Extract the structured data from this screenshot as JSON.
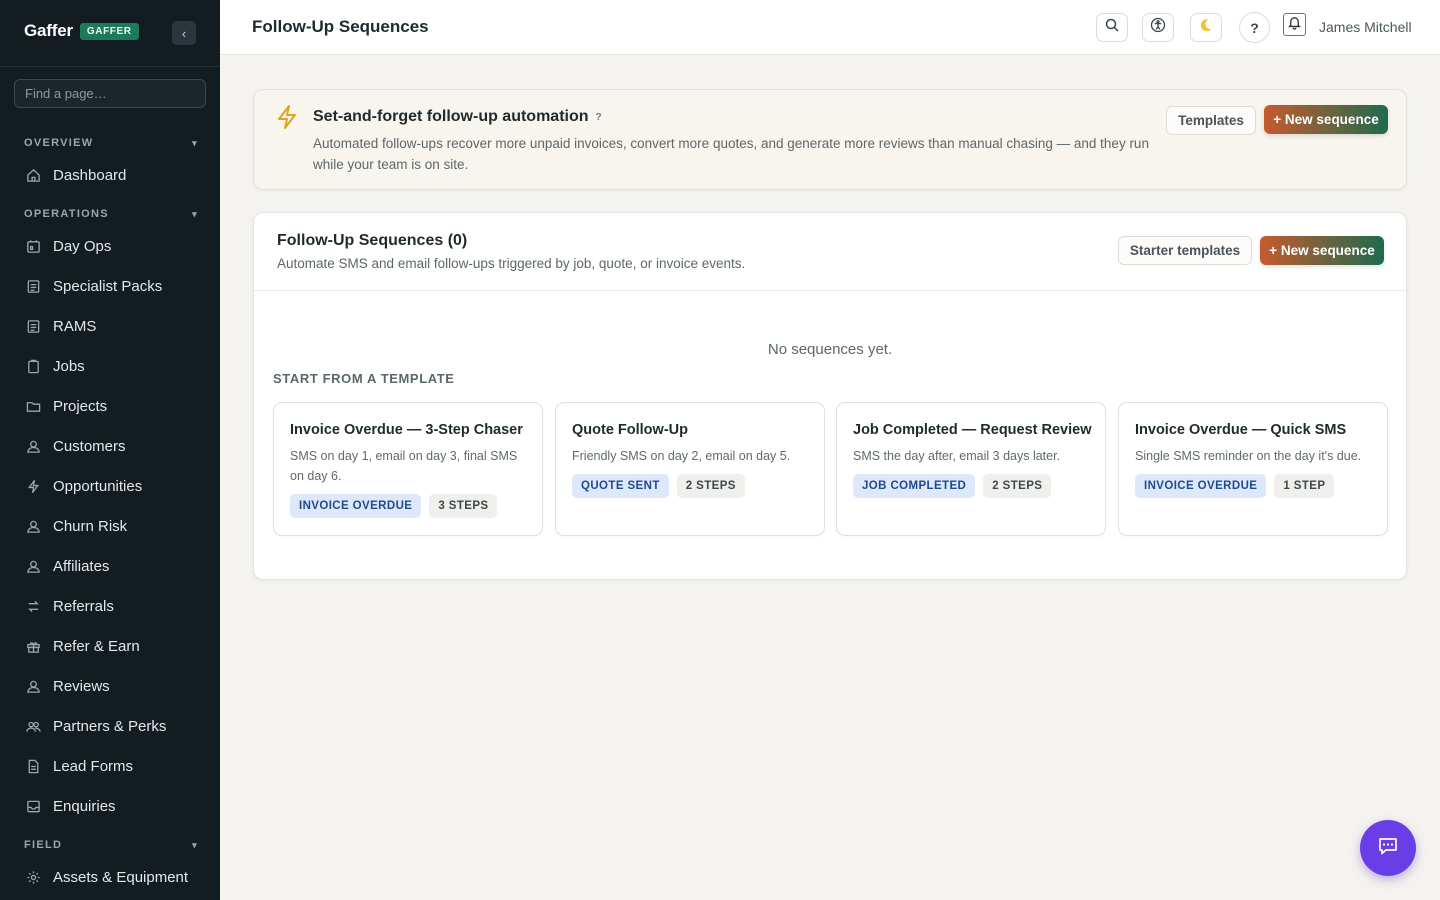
{
  "app": {
    "name": "Gaffer",
    "badge": "GAFFER"
  },
  "sidebar": {
    "search_placeholder": "Find a page…",
    "sections": {
      "overview": "OVERVIEW",
      "operations": "OPERATIONS",
      "field": "FIELD"
    },
    "items": {
      "dashboard": "Dashboard",
      "day_ops": "Day Ops",
      "specialist_packs": "Specialist Packs",
      "rams": "RAMS",
      "jobs": "Jobs",
      "projects": "Projects",
      "customers": "Customers",
      "opportunities": "Opportunities",
      "churn_risk": "Churn Risk",
      "affiliates": "Affiliates",
      "referrals": "Referrals",
      "refer_earn": "Refer & Earn",
      "reviews": "Reviews",
      "partners_perks": "Partners & Perks",
      "lead_forms": "Lead Forms",
      "enquiries": "Enquiries",
      "assets_equipment": "Assets & Equipment"
    }
  },
  "header": {
    "title": "Follow-Up Sequences",
    "help": "?",
    "user": "James Mitchell"
  },
  "banner": {
    "title": "Set-and-forget follow-up automation",
    "help": "?",
    "description": "Automated follow-ups recover more unpaid invoices, convert more quotes, and generate more reviews than manual chasing — and they run while your team is on site.",
    "templates_label": "Templates",
    "new_label": "+ New sequence"
  },
  "card": {
    "title": "Follow-Up Sequences (0)",
    "subtitle": "Automate SMS and email follow-ups triggered by job, quote, or invoice events.",
    "starter_label": "Starter templates",
    "new_label": "+ New sequence",
    "empty": "No sequences yet.",
    "templates_heading": "START FROM A TEMPLATE",
    "templates": [
      {
        "title": "Invoice Overdue — 3-Step Chaser",
        "description": "SMS on day 1, email on day 3, final SMS on day 6.",
        "trigger": "INVOICE OVERDUE",
        "steps": "3 STEPS"
      },
      {
        "title": "Quote Follow-Up",
        "description": "Friendly SMS on day 2, email on day 5.",
        "trigger": "QUOTE SENT",
        "steps": "2 STEPS"
      },
      {
        "title": "Job Completed — Request Review",
        "description": "SMS the day after, email 3 days later.",
        "trigger": "JOB COMPLETED",
        "steps": "2 STEPS"
      },
      {
        "title": "Invoice Overdue — Quick SMS",
        "description": "Single SMS reminder on the day it's due.",
        "trigger": "INVOICE OVERDUE",
        "steps": "1 STEP"
      }
    ]
  },
  "colors": {
    "sidebar_bg": "#131d21",
    "brand_badge": "#1e7a5c",
    "accent_gradient_start": "#c65a2e",
    "accent_gradient_end": "#1f6a4f",
    "chat_bubble": "#6a3ee6",
    "tag_blue_bg": "#dde9fb"
  }
}
